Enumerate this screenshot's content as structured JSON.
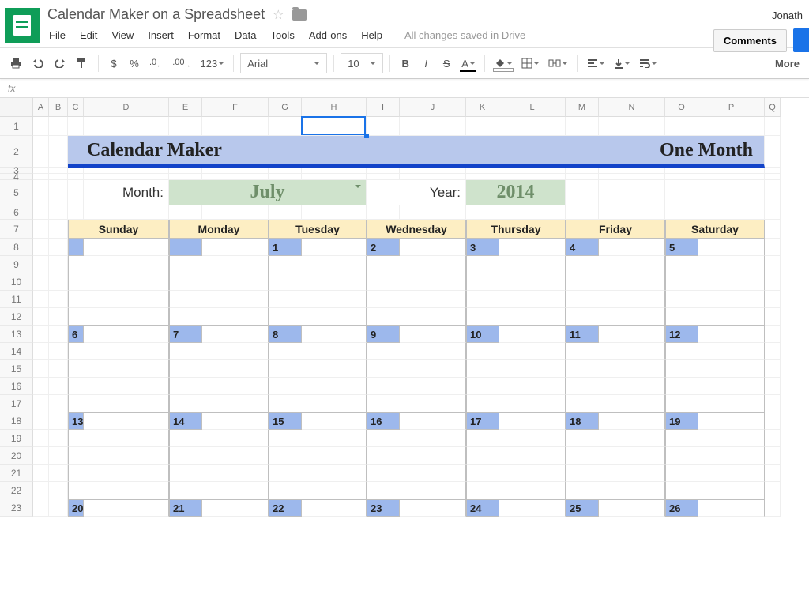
{
  "doc": {
    "title": "Calendar Maker on a Spreadsheet",
    "saved": "All changes saved in Drive"
  },
  "user": "Jonath",
  "menus": {
    "file": "File",
    "edit": "Edit",
    "view": "View",
    "insert": "Insert",
    "format": "Format",
    "data": "Data",
    "tools": "Tools",
    "addons": "Add-ons",
    "help": "Help"
  },
  "buttons": {
    "comments": "Comments",
    "more": "More"
  },
  "toolbar": {
    "dollar": "$",
    "percent": "%",
    "dec_dec": ".0",
    "dec_inc": ".00",
    "num": "123",
    "font": "Arial",
    "size": "10",
    "bold": "B",
    "italic": "I",
    "strike": "S",
    "tcolor": "A"
  },
  "fx": "fx",
  "cols": [
    "A",
    "B",
    "C",
    "D",
    "E",
    "F",
    "G",
    "H",
    "I",
    "J",
    "K",
    "L",
    "M",
    "N",
    "O",
    "P",
    "Q"
  ],
  "rowNums": [
    "1",
    "2",
    "3",
    "4",
    "5",
    "6",
    "7",
    "8",
    "9",
    "10",
    "11",
    "12",
    "13",
    "14",
    "15",
    "16",
    "17",
    "18",
    "19",
    "20",
    "21",
    "22",
    "23"
  ],
  "sheet": {
    "banner_left": "Calendar Maker",
    "banner_right": "One Month",
    "month_label": "Month:",
    "month": "July",
    "year_label": "Year:",
    "year": "2014",
    "days": [
      "Sunday",
      "Monday",
      "Tuesday",
      "Wednesday",
      "Thursday",
      "Friday",
      "Saturday"
    ],
    "weeks": [
      [
        "",
        "",
        "1",
        "2",
        "3",
        "4",
        "5"
      ],
      [
        "6",
        "7",
        "8",
        "9",
        "10",
        "11",
        "12"
      ],
      [
        "13",
        "14",
        "15",
        "16",
        "17",
        "18",
        "19"
      ],
      [
        "20",
        "21",
        "22",
        "23",
        "24",
        "25",
        "26"
      ]
    ]
  },
  "rowHeights": {
    "1": 24,
    "2": 40,
    "3": 8,
    "4": 8,
    "5": 32,
    "6": 18,
    "7": 24,
    "8": 22,
    "9": 22,
    "10": 22,
    "11": 22,
    "12": 22,
    "13": 22,
    "14": 22,
    "15": 22,
    "16": 22,
    "17": 22,
    "18": 22,
    "19": 22,
    "20": 22,
    "21": 22,
    "22": 22,
    "23": 22
  }
}
